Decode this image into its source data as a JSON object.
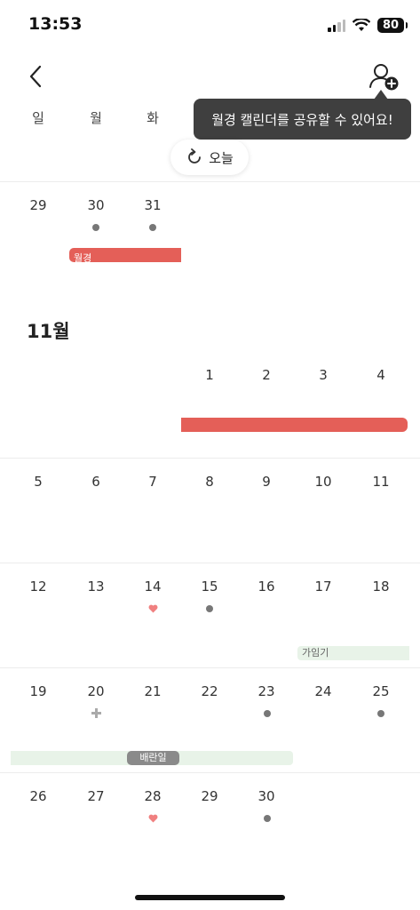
{
  "status_bar": {
    "time": "13:53",
    "battery": "80"
  },
  "weekdays": [
    "일",
    "월",
    "화"
  ],
  "tooltip": {
    "text": "월경 캘린더를 공유할 수 있어요!"
  },
  "today_button": {
    "label": "오늘"
  },
  "october_partial": {
    "days": [
      "29",
      "30",
      "31"
    ]
  },
  "period_label": "월경",
  "november": {
    "title": "11월",
    "week1": [
      "1",
      "2",
      "3",
      "4"
    ],
    "week2": [
      "5",
      "6",
      "7",
      "8",
      "9",
      "10",
      "11"
    ],
    "week3": [
      "12",
      "13",
      "14",
      "15",
      "16",
      "17",
      "18"
    ],
    "week4": [
      "19",
      "20",
      "21",
      "22",
      "23",
      "24",
      "25"
    ],
    "week5": [
      "26",
      "27",
      "28",
      "29",
      "30"
    ]
  },
  "fertile_label": "가임기",
  "ovulation_label": "배란일",
  "colors": {
    "period": "#e45f58",
    "fertile": "#e8f3e8",
    "tooltip_bg": "#3f3f3f",
    "dot": "#777777",
    "heart": "#f08080"
  },
  "icons": [
    "back-chevron-icon",
    "share-user-plus-icon",
    "refresh-icon",
    "heart-icon",
    "plus-icon"
  ]
}
